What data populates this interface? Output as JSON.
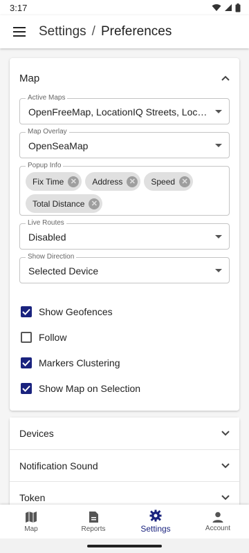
{
  "status": {
    "time": "3:17"
  },
  "header": {
    "crumb_parent": "Settings",
    "separator": "/",
    "crumb_current": "Preferences"
  },
  "map_panel": {
    "title": "Map",
    "fields": {
      "active_maps": {
        "label": "Active Maps",
        "value": "OpenFreeMap, LocationIQ Streets, Location"
      },
      "map_overlay": {
        "label": "Map Overlay",
        "value": "OpenSeaMap"
      },
      "popup_info": {
        "label": "Popup Info",
        "chips": [
          "Fix Time",
          "Address",
          "Speed",
          "Total Distance"
        ]
      },
      "live_routes": {
        "label": "Live Routes",
        "value": "Disabled"
      },
      "show_direction": {
        "label": "Show Direction",
        "value": "Selected Device"
      }
    },
    "checkboxes": [
      {
        "label": "Show Geofences",
        "checked": true
      },
      {
        "label": "Follow",
        "checked": false
      },
      {
        "label": "Markers Clustering",
        "checked": true
      },
      {
        "label": "Show Map on Selection",
        "checked": true
      }
    ]
  },
  "sections": [
    "Devices",
    "Notification Sound",
    "Token"
  ],
  "bottom_nav": [
    {
      "label": "Map",
      "icon": "map-icon",
      "active": false
    },
    {
      "label": "Reports",
      "icon": "description-icon",
      "active": false
    },
    {
      "label": "Settings",
      "icon": "gear-icon",
      "active": true
    },
    {
      "label": "Account",
      "icon": "person-icon",
      "active": false
    }
  ],
  "colors": {
    "accent": "#1a237e",
    "chip_bg": "#e0e0e0",
    "border": "#c4c4c4"
  }
}
